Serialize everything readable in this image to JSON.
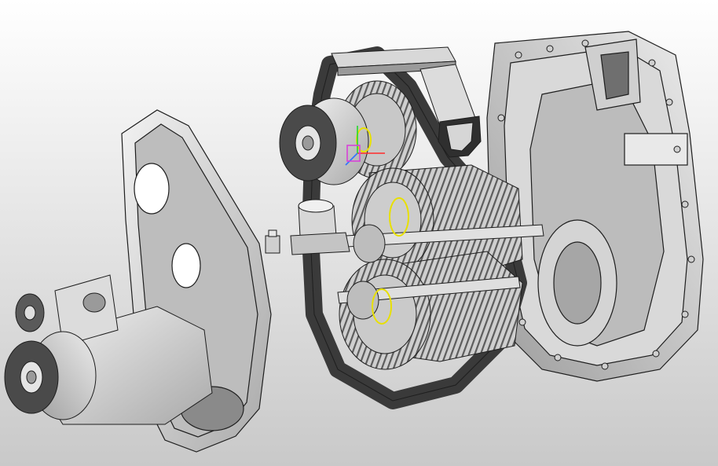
{
  "viewport": {
    "background_top": "#ffffff",
    "background_bottom": "#c9c9c9"
  },
  "model": {
    "depicts": [
      "input-housing-with-flange",
      "front-cover-plate",
      "sensor-plug",
      "gasket-plate",
      "gear-train",
      "output-flange-upper",
      "rear-gearbox-housing"
    ],
    "colors": {
      "metal_light": "#e6e6e6",
      "metal_mid": "#bdbdbd",
      "metal_dark": "#6f6f6f",
      "gasket": "#3a3a3a",
      "edge": "#1e1e1e",
      "flange_face": "#4a4a4a"
    }
  },
  "selection_markers": {
    "color": "#e8e000",
    "count": 3
  },
  "triad": {
    "axis_colors": [
      "#ff2a2a",
      "#25d82a",
      "#2f74ff"
    ],
    "accent": "#d742d7"
  }
}
